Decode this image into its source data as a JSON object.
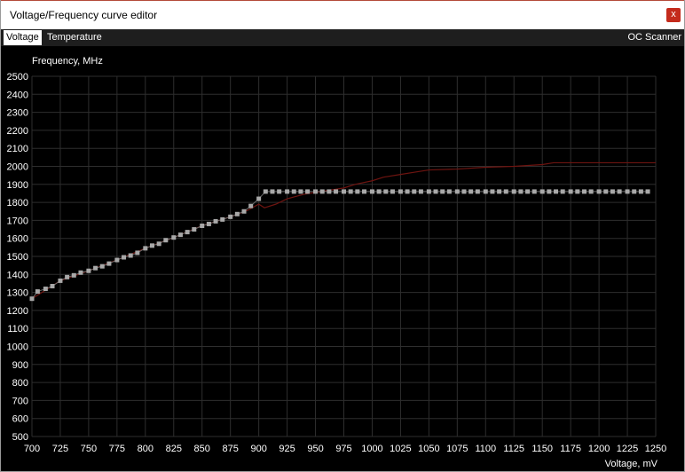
{
  "window": {
    "title": "Voltage/Frequency curve editor",
    "close_label": "x"
  },
  "tabs": [
    {
      "label": "Voltage",
      "active": true
    },
    {
      "label": "Temperature",
      "active": false
    }
  ],
  "oc_scanner_label": "OC Scanner",
  "colors": {
    "background": "#000000",
    "grid": "#2e2e2e",
    "curve_points": "#a8a8a8",
    "reference_curve": "#6e1410",
    "accent_close": "#c42b1c"
  },
  "chart_data": {
    "type": "line",
    "ylabel": "Frequency, MHz",
    "xlabel": "Voltage, mV",
    "xlim": [
      700,
      1250
    ],
    "ylim": [
      500,
      2500
    ],
    "x_ticks": [
      700,
      725,
      750,
      775,
      800,
      825,
      850,
      875,
      900,
      925,
      950,
      975,
      1000,
      1025,
      1050,
      1075,
      1100,
      1125,
      1150,
      1175,
      1200,
      1225,
      1250
    ],
    "y_ticks": [
      500,
      600,
      700,
      800,
      900,
      1000,
      1100,
      1200,
      1300,
      1400,
      1500,
      1600,
      1700,
      1800,
      1900,
      2000,
      2100,
      2200,
      2300,
      2400,
      2500
    ],
    "grid": true,
    "series": [
      {
        "style": "points",
        "x": [
          700,
          705,
          712,
          718,
          725,
          731,
          737,
          743,
          750,
          756,
          762,
          768,
          775,
          781,
          787,
          793,
          800,
          806,
          812,
          818,
          825,
          831,
          837,
          843,
          850,
          856,
          862,
          868,
          875,
          881,
          887,
          893,
          900,
          906,
          912,
          918,
          925,
          931,
          937,
          943,
          950,
          956,
          962,
          968,
          975,
          981,
          987,
          993,
          1000,
          1006,
          1012,
          1018,
          1025,
          1031,
          1037,
          1043,
          1050,
          1056,
          1062,
          1068,
          1075,
          1081,
          1087,
          1093,
          1100,
          1106,
          1112,
          1118,
          1125,
          1131,
          1137,
          1143,
          1150,
          1156,
          1162,
          1168,
          1175,
          1181,
          1187,
          1193,
          1200,
          1206,
          1212,
          1218,
          1225,
          1231,
          1237,
          1243
        ],
        "y": [
          1265,
          1305,
          1320,
          1335,
          1365,
          1385,
          1395,
          1410,
          1420,
          1435,
          1445,
          1460,
          1480,
          1495,
          1505,
          1520,
          1545,
          1560,
          1570,
          1590,
          1605,
          1620,
          1635,
          1650,
          1670,
          1680,
          1695,
          1705,
          1720,
          1735,
          1750,
          1780,
          1820,
          1860,
          1860,
          1860,
          1860,
          1860,
          1860,
          1860,
          1860,
          1860,
          1860,
          1860,
          1860,
          1860,
          1860,
          1860,
          1860,
          1860,
          1860,
          1860,
          1860,
          1860,
          1860,
          1860,
          1860,
          1860,
          1860,
          1860,
          1860,
          1860,
          1860,
          1860,
          1860,
          1860,
          1860,
          1860,
          1860,
          1860,
          1860,
          1860,
          1860,
          1860,
          1860,
          1860,
          1860,
          1860,
          1860,
          1860,
          1860,
          1860,
          1860,
          1860,
          1860,
          1860,
          1860,
          1860
        ]
      },
      {
        "style": "line",
        "x": [
          700,
          725,
          750,
          775,
          800,
          825,
          850,
          875,
          890,
          900,
          905,
          915,
          925,
          940,
          960,
          975,
          985,
          1000,
          1010,
          1025,
          1040,
          1050,
          1075,
          1100,
          1125,
          1150,
          1160,
          1175,
          1200,
          1225,
          1250
        ],
        "y": [
          1265,
          1365,
          1420,
          1480,
          1545,
          1605,
          1670,
          1720,
          1755,
          1790,
          1770,
          1790,
          1820,
          1845,
          1865,
          1880,
          1900,
          1920,
          1940,
          1955,
          1970,
          1980,
          1985,
          1995,
          2000,
          2010,
          2020,
          2020,
          2020,
          2020,
          2020
        ]
      }
    ]
  }
}
